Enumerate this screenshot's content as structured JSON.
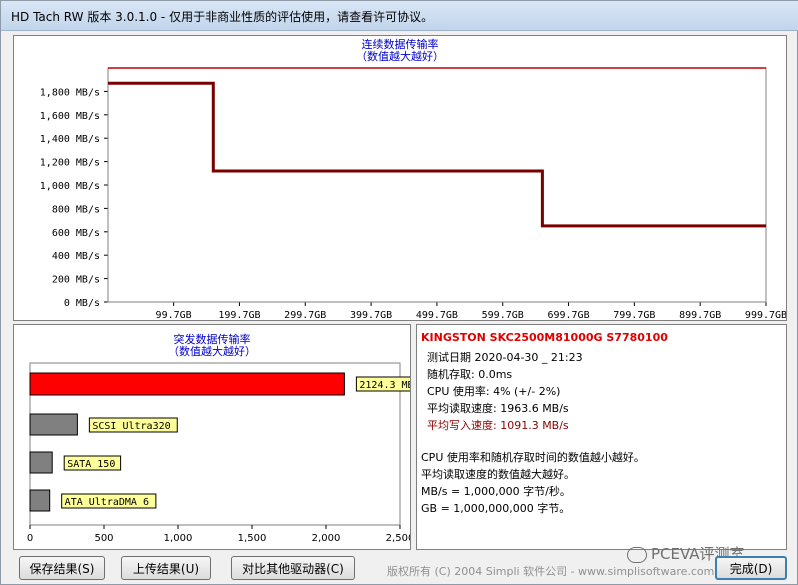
{
  "window": {
    "title": "HD Tach RW 版本 3.0.1.0  - 仅用于非商业性质的评估使用，请查看许可协议。"
  },
  "seq_chart": {
    "title_line1": "连续数据传输率",
    "title_line2": "（数值越大越好）",
    "y_ticks": [
      "1,800 MB/s",
      "1,600 MB/s",
      "1,400 MB/s",
      "1,200 MB/s",
      "1,000 MB/s",
      "800 MB/s",
      "600 MB/s",
      "400 MB/s",
      "200 MB/s",
      "0 MB/s"
    ],
    "x_ticks": [
      "99.7GB",
      "199.7GB",
      "299.7GB",
      "399.7GB",
      "499.7GB",
      "599.7GB",
      "699.7GB",
      "799.7GB",
      "899.7GB",
      "999.7GB"
    ]
  },
  "chart_data": [
    {
      "type": "line",
      "title": "连续数据传输率",
      "subtitle": "（数值越大越好）",
      "xlabel": "",
      "ylabel": "",
      "xlim": [
        0,
        999.7
      ],
      "ylim": [
        0,
        2000
      ],
      "grid": false,
      "series": [
        {
          "name": "",
          "color": "#c00000",
          "x": [
            0,
            999.7
          ],
          "values": [
            2000,
            2000
          ]
        },
        {
          "name": "",
          "color": "#7a0000",
          "x": [
            0,
            160,
            160,
            660,
            660,
            999.7
          ],
          "values": [
            1870,
            1870,
            1120,
            1120,
            650,
            650
          ]
        }
      ]
    },
    {
      "type": "bar",
      "title": "突发数据传输率",
      "subtitle": "（数值越大越好）",
      "orientation": "horizontal",
      "categories": [
        "",
        "SCSI Ultra320",
        "SATA 150",
        "ATA UltraDMA 6"
      ],
      "values": [
        2124.3,
        320,
        150,
        133
      ],
      "value_labels": [
        "2124.3 MB/s",
        "SCSI Ultra320",
        "SATA 150",
        "ATA UltraDMA 6"
      ],
      "colors": [
        "#ff0000",
        "#808080",
        "#808080",
        "#808080"
      ],
      "xlim": [
        0,
        2500
      ],
      "x_ticks": [
        "0",
        "500",
        "1,000",
        "1,500",
        "2,000",
        "2,500"
      ]
    }
  ],
  "burst_chart": {
    "title_line1": "突发数据传输率",
    "title_line2": "（数值越大越好）",
    "labels": [
      "2124.3 MB/s",
      "SCSI Ultra320",
      "SATA 150",
      "ATA UltraDMA 6"
    ],
    "x_ticks": [
      "0",
      "500",
      "1,000",
      "1,500",
      "2,000",
      "2,500"
    ]
  },
  "info": {
    "drive": "KINGSTON SKC2500M81000G S7780100",
    "date": "测试日期 2020-04-30 _ 21:23",
    "random": "随机存取: 0.0ms",
    "cpu": "CPU 使用率: 4% (+/- 2%)",
    "avg_read": "平均读取速度: 1963.6 MB/s",
    "avg_write": "平均写入速度: 1091.3 MB/s",
    "note1": "CPU 使用率和随机存取时间的数值越小越好。",
    "note2": "平均读取速度的数值越大越好。",
    "note3": "MB/s = 1,000,000 字节/秒。",
    "note4": "GB = 1,000,000,000 字节。"
  },
  "buttons": {
    "save": "保存结果(S)",
    "upload": "上传结果(U)",
    "compare": "对比其他驱动器(C)",
    "done": "完成(D)"
  },
  "footer": {
    "copyright": "版权所有 (C) 2004 Simpli 软件公司 - www.simplisoftware.com",
    "watermark": "PCEVA评测室"
  },
  "colors": {
    "read": "#c00000",
    "write": "#7a0000",
    "burst_bar": "#ff0000",
    "ref_bar": "#808080",
    "label_bg": "#ffff99"
  }
}
